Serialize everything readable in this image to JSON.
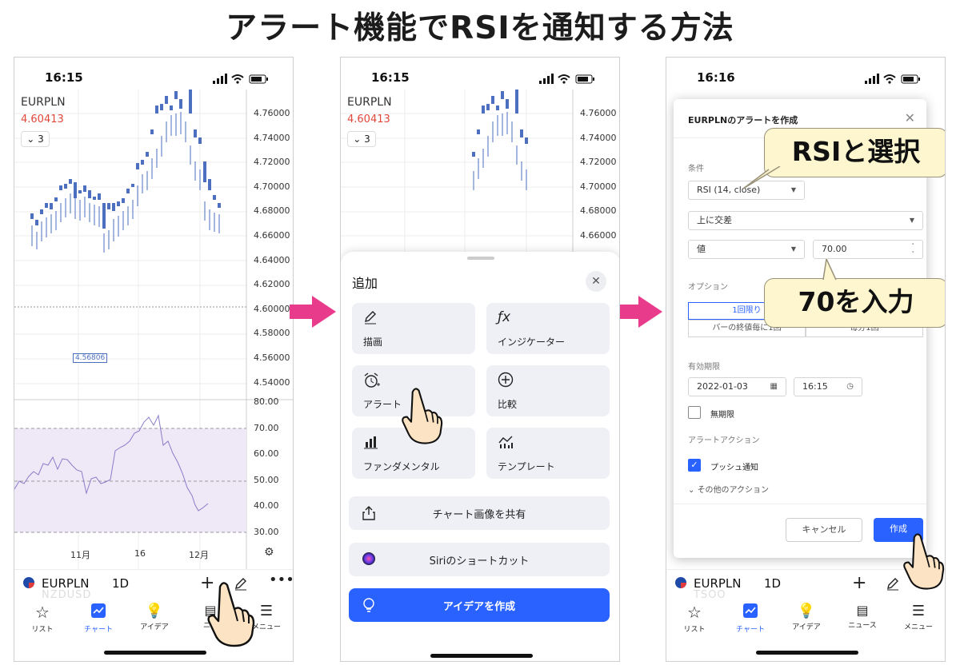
{
  "title": "アラート機能でRSIを通知する方法",
  "status": {
    "time1": "16:15",
    "time2": "16:15",
    "time3": "16:16"
  },
  "chart": {
    "symbol": "EURPLN",
    "price": "4.60413",
    "interval_label": "3",
    "low_label": "4.56806",
    "price_axis": [
      "4.76000",
      "4.74000",
      "4.72000",
      "4.70000",
      "4.68000",
      "4.66000",
      "4.64000",
      "4.62000",
      "4.60000",
      "4.58000",
      "4.56000",
      "4.54000"
    ],
    "rsi_axis": [
      "80.00",
      "70.00",
      "60.00",
      "50.00",
      "40.00",
      "30.00"
    ],
    "x_ticks": [
      "11月",
      "16",
      "12月"
    ]
  },
  "bottombar": {
    "symbol": "EURPLN",
    "interval": "1D",
    "ghost1": "NZDUSD",
    "ghost2": "TSOO"
  },
  "tabs": [
    "リスト",
    "チャート",
    "アイデア",
    "ニュース",
    "メニュー"
  ],
  "tab_partial_news": "ニュ",
  "sheet": {
    "title": "追加",
    "cards": [
      "描画",
      "インジケーター",
      "アラート",
      "比較",
      "ファンダメンタル",
      "テンプレート"
    ],
    "share": "チャート画像を共有",
    "siri": "Siriのショートカット",
    "create_idea": "アイデアを作成"
  },
  "dialog": {
    "title": "EURPLNのアラートを作成",
    "condition_label": "条件",
    "indicator": "RSI (14, close)",
    "crossing": "上に交差",
    "value_type": "値",
    "value": "70.00",
    "options_label": "オプション",
    "opt_once": "1回限り",
    "opt_bar_close": "バーの終値毎に1回",
    "opt_every_min": "毎分1回",
    "expiry_label": "有効期限",
    "date": "2022-01-03",
    "time": "16:15",
    "no_expiry": "無期限",
    "actions_label": "アラートアクション",
    "push": "プッシュ通知",
    "other_actions": "その他のアクション",
    "cancel": "キャンセル",
    "create": "作成"
  },
  "callouts": {
    "rsi": "RSIと選択",
    "seventy": "70を入力"
  },
  "colors": {
    "up": "#e57368",
    "down": "#4c6fbf",
    "accent": "#2962ff",
    "arrow": "#e93b8b"
  }
}
